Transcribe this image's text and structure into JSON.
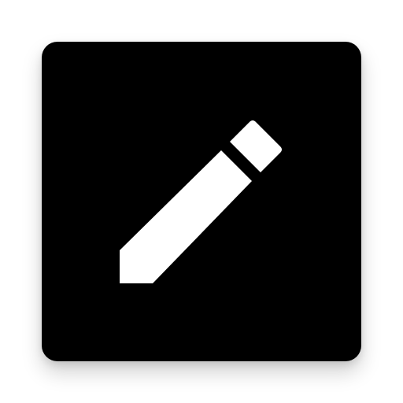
{
  "icon": {
    "name": "pencil-icon",
    "background_color": "#000000",
    "glyph_color": "#ffffff",
    "page_background": "#ffffff"
  }
}
